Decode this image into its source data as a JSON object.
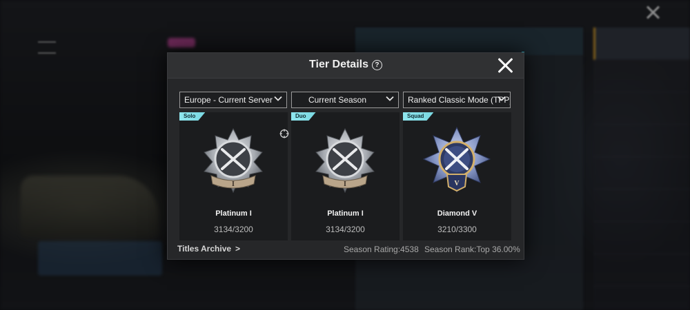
{
  "modal": {
    "title": "Tier Details",
    "help_icon": "question-circle-icon",
    "close_icon": "close-x-icon"
  },
  "selectors": {
    "server": "Europe - Current Server",
    "season": "Current Season",
    "mode": "Ranked Classic Mode (TPP)"
  },
  "cards": [
    {
      "tag": "Solo",
      "tier": "Platinum I",
      "points": "3134/3200",
      "numeral": "I",
      "badge_color": "#c9ccd0"
    },
    {
      "tag": "Duo",
      "tier": "Platinum I",
      "points": "3134/3200",
      "numeral": "I",
      "badge_color": "#c9ccd0"
    },
    {
      "tag": "Squad",
      "tier": "Diamond V",
      "points": "3210/3300",
      "numeral": "V",
      "badge_color": "#6f86c8"
    }
  ],
  "footer": {
    "titles_archive": "Titles Archive",
    "arrow": ">",
    "season_rating": "Season Rating:4538",
    "season_rank": "Season Rank:Top 36.00%"
  },
  "colors": {
    "tag_bg": "#8fe6ee",
    "platinum": "#c9ccd0",
    "diamond": "#6f86c8",
    "diamond_gold": "#d4b06a"
  }
}
